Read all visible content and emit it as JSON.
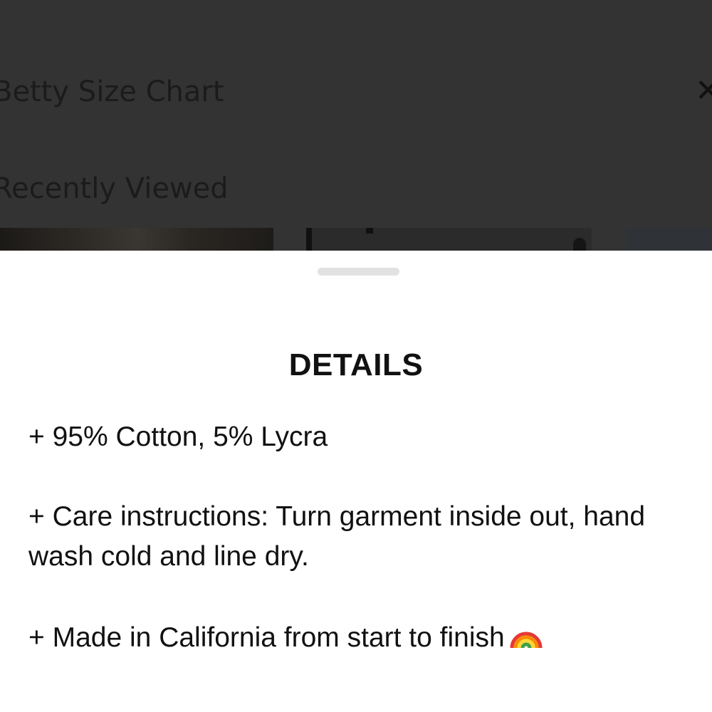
{
  "background": {
    "size_chart_link": "Betty Size Chart",
    "recently_viewed_heading": "Recently Viewed",
    "close_icon": "close-icon"
  },
  "sheet": {
    "title": "DETAILS",
    "details": [
      "+ 95% Cotton, 5% Lycra",
      "+ Care instructions: Turn garment inside out, hand wash cold and line dry.",
      "+ Made in California from start to finish"
    ],
    "finish_icon": "rainbow-icon"
  },
  "colors": {
    "backdrop": "#333333",
    "sheet_background": "#ffffff",
    "text": "#111111",
    "handle": "#e2e2e2"
  }
}
